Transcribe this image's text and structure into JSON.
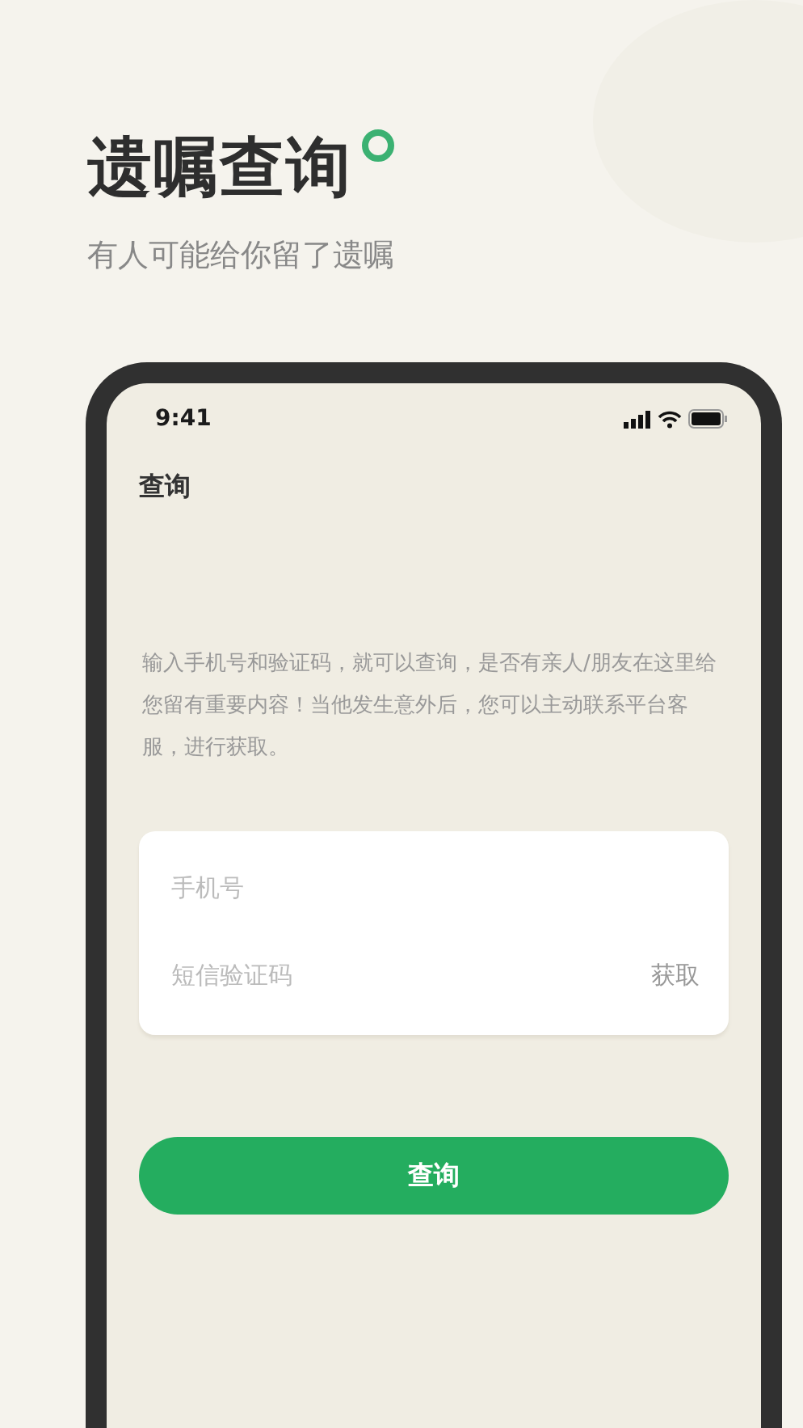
{
  "header": {
    "title": "遗嘱查询",
    "subtitle": "有人可能给你留了遗嘱"
  },
  "phone": {
    "status_bar": {
      "time": "9:41"
    },
    "page_title": "查询",
    "description": "输入手机号和验证码，就可以查询，是否有亲人/朋友在这里给您留有重要内容！当他发生意外后，您可以主动联系平台客服，进行获取。",
    "form": {
      "phone_field": {
        "placeholder": "手机号"
      },
      "code_field": {
        "placeholder": "短信验证码"
      },
      "get_code_button": "获取"
    },
    "submit_button": "查询"
  }
}
